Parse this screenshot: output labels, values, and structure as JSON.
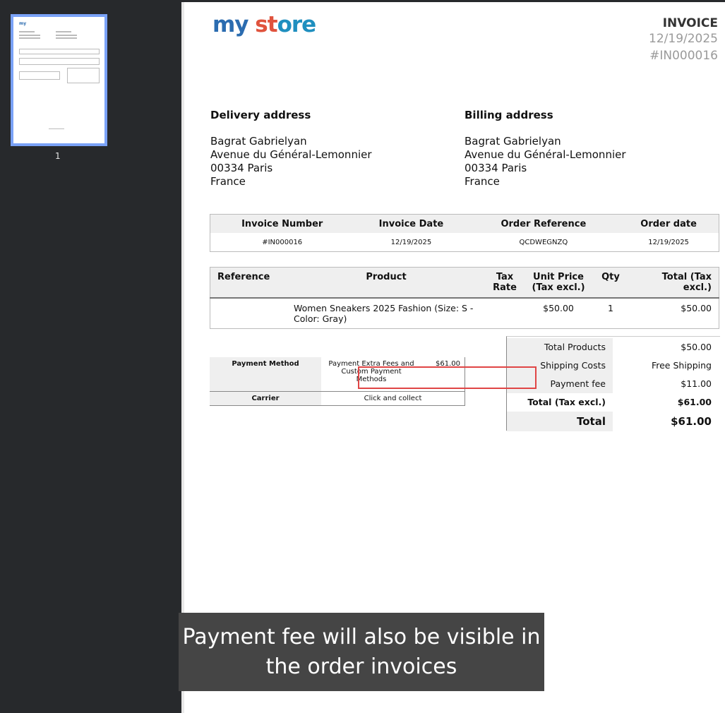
{
  "sidebar": {
    "page_number": "1"
  },
  "header": {
    "logo_parts": [
      "my",
      " st",
      "ore"
    ],
    "title": "INVOICE",
    "date": "12/19/2025",
    "number": "#IN000016"
  },
  "delivery": {
    "heading": "Delivery address",
    "lines": [
      "Bagrat Gabrielyan",
      "Avenue du Général-Lemonnier",
      "00334 Paris",
      "France"
    ]
  },
  "billing": {
    "heading": "Billing address",
    "lines": [
      "Bagrat Gabrielyan",
      "Avenue du Général-Lemonnier",
      "00334 Paris",
      "France"
    ]
  },
  "info_table": {
    "headers": [
      "Invoice Number",
      "Invoice Date",
      "Order Reference",
      "Order date"
    ],
    "values": [
      "#IN000016",
      "12/19/2025",
      "QCDWEGNZQ",
      "12/19/2025"
    ]
  },
  "product_table": {
    "headers": [
      "Reference",
      "Product",
      "Tax Rate",
      "Unit Price (Tax excl.)",
      "Qty",
      "Total (Tax excl.)"
    ],
    "rows": [
      [
        "",
        "Women Sneakers 2025 Fashion (Size: S - Color: Gray)",
        "",
        "$50.00",
        "1",
        "$50.00"
      ]
    ]
  },
  "payment": {
    "method_label": "Payment Method",
    "method_value": "Payment Extra Fees and Custom Payment Methods",
    "method_amount": "$61.00",
    "carrier_label": "Carrier",
    "carrier_value": "Click and collect"
  },
  "totals": [
    {
      "label": "Total Products",
      "value": "$50.00"
    },
    {
      "label": "Shipping Costs",
      "value": "Free Shipping"
    },
    {
      "label": "Payment fee",
      "value": "$11.00"
    },
    {
      "label": "Total (Tax excl.)",
      "value": "$61.00"
    },
    {
      "label": "Total",
      "value": "$61.00"
    }
  ],
  "caption": "Payment fee will also be visible in the order invoices"
}
